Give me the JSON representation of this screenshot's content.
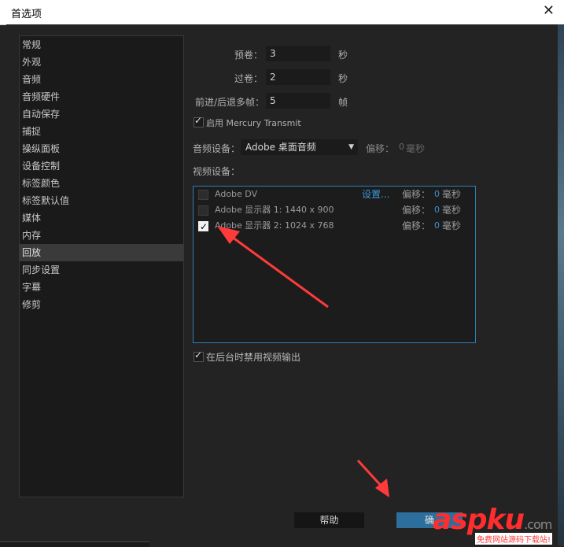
{
  "window": {
    "title": "首选项"
  },
  "sidebar": {
    "items": [
      {
        "label": "常规"
      },
      {
        "label": "外观"
      },
      {
        "label": "音频"
      },
      {
        "label": "音频硬件"
      },
      {
        "label": "自动保存"
      },
      {
        "label": "捕捉"
      },
      {
        "label": "操纵面板"
      },
      {
        "label": "设备控制"
      },
      {
        "label": "标签颜色"
      },
      {
        "label": "标签默认值"
      },
      {
        "label": "媒体"
      },
      {
        "label": "内存"
      },
      {
        "label": "回放"
      },
      {
        "label": "同步设置"
      },
      {
        "label": "字幕"
      },
      {
        "label": "修剪"
      }
    ],
    "selected": "回放"
  },
  "playback": {
    "preroll": {
      "label": "预卷：",
      "value": "3",
      "unit": "秒"
    },
    "postroll": {
      "label": "过卷：",
      "value": "2",
      "unit": "秒"
    },
    "step": {
      "label": "前进/后退多帧：",
      "value": "5",
      "unit": "帧"
    },
    "mercury": {
      "label": "启用 Mercury Transmit",
      "checked": true
    },
    "audio_device": {
      "label": "音频设备：",
      "value": "Adobe 桌面音频",
      "offset_label": "偏移：",
      "offset_value": "0",
      "offset_unit": "毫秒"
    },
    "video_device_label": "视频设备：",
    "video_devices": [
      {
        "name": "Adobe DV",
        "checked": false,
        "settings": "设置...",
        "offset_label": "偏移：",
        "offset": "0",
        "unit": "毫秒"
      },
      {
        "name": "Adobe 显示器 1: 1440 x 900",
        "checked": false,
        "offset_label": "偏移：",
        "offset": "0",
        "unit": "毫秒"
      },
      {
        "name": "Adobe 显示器 2: 1024 x 768",
        "checked": true,
        "offset_label": "偏移：",
        "offset": "0",
        "unit": "毫秒"
      }
    ],
    "disable_background": {
      "label": "在后台时禁用视频输出",
      "checked": true
    }
  },
  "buttons": {
    "help": "帮助",
    "ok": "确"
  },
  "watermark": {
    "logo": "aspku",
    "tld": ".com",
    "tagline": "免费网站源码下载站!"
  },
  "colors": {
    "accent": "#2d6f9c",
    "link": "#3b9ad9",
    "annotation": "#ff3a3a"
  }
}
